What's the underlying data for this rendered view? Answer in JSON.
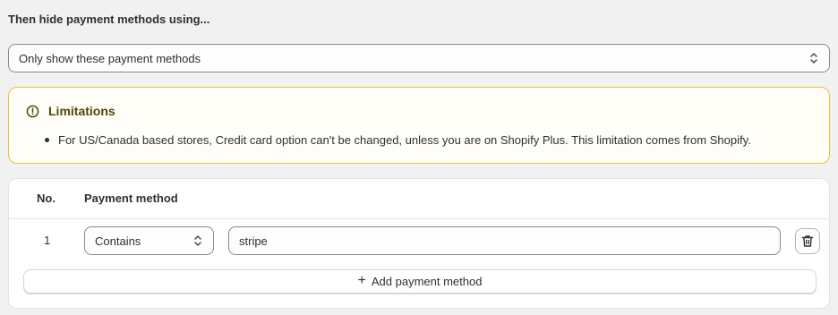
{
  "section": {
    "title": "Then hide payment methods using..."
  },
  "mode_select": {
    "value": "Only show these payment methods",
    "icon": "chevron-updown-icon"
  },
  "banner": {
    "icon": "alert-circle-icon",
    "title": "Limitations",
    "items": [
      "For US/Canada based stores, Credit card option can't be changed, unless you are on Shopify Plus. This limitation comes from Shopify."
    ],
    "colors": {
      "border": "#f0c03b",
      "title": "#4f4700"
    }
  },
  "table": {
    "headers": {
      "no": "No.",
      "method": "Payment method"
    },
    "rows": [
      {
        "no": "1",
        "operator": "Contains",
        "value": "stripe"
      }
    ],
    "add_label": "Add payment method"
  }
}
